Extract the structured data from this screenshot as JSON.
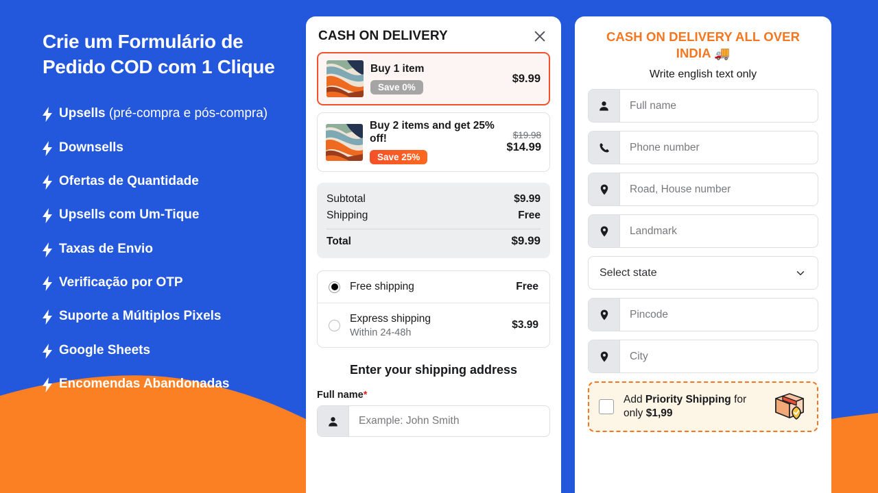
{
  "colors": {
    "brand_blue": "#2357DC",
    "brand_orange": "#FB8024",
    "accent_red": "#F4502A",
    "title_orange": "#F4761F",
    "badge_grey": "#A5A5A5"
  },
  "promo": {
    "title": "Crie um Formulário de Pedido COD com 1 Clique",
    "features": [
      {
        "strong": "Upsells",
        "rest": " (pré-compra e pós-compra)"
      },
      {
        "strong": "Downsells",
        "rest": ""
      },
      {
        "strong": "Ofertas de Quantidade",
        "rest": ""
      },
      {
        "strong": "Upsells com Um-Tique",
        "rest": ""
      },
      {
        "strong": "Taxas de Envio",
        "rest": ""
      },
      {
        "strong": "Verificação por OTP",
        "rest": ""
      },
      {
        "strong": "Suporte a Múltiplos Pixels",
        "rest": ""
      },
      {
        "strong": "Google Sheets",
        "rest": ""
      },
      {
        "strong": "Encomendas Abandonadas",
        "rest": ""
      }
    ]
  },
  "cart": {
    "title": "CASH ON DELIVERY",
    "close_label": "✕",
    "offers": [
      {
        "name": "Buy 1 item",
        "badge": "Save 0%",
        "badge_style": "grey",
        "price": "$9.99",
        "compare_at": "",
        "selected": true
      },
      {
        "name": "Buy 2 items and get 25% off!",
        "badge": "Save 25%",
        "badge_style": "hot",
        "price": "$14.99",
        "compare_at": "$19.98",
        "selected": false
      }
    ],
    "totals": [
      {
        "label": "Subtotal",
        "value": "$9.99"
      },
      {
        "label": "Shipping",
        "value": "Free"
      }
    ],
    "total": {
      "label": "Total",
      "value": "$9.99"
    },
    "shipping_methods": [
      {
        "name": "Free shipping",
        "sub": "",
        "cost": "Free",
        "selected": true
      },
      {
        "name": "Express shipping",
        "sub": "Within 24-48h",
        "cost": "$3.99",
        "selected": false
      }
    ],
    "address_heading": "Enter your shipping address",
    "fullname_label": "Full name",
    "required_mark": "*",
    "fullname_placeholder": "Example: John Smith"
  },
  "form": {
    "title": "CASH ON DELIVERY ALL OVER INDIA 🚚",
    "subtitle": "Write english text only",
    "fields": [
      {
        "icon": "person-icon",
        "placeholder": "Full name"
      },
      {
        "icon": "phone-icon",
        "placeholder": "Phone number"
      },
      {
        "icon": "location-icon",
        "placeholder": "Road, House number"
      },
      {
        "icon": "location-icon",
        "placeholder": "Landmark"
      }
    ],
    "state_select": {
      "value": "Select state"
    },
    "fields_after": [
      {
        "icon": "location-icon",
        "placeholder": "Pincode"
      },
      {
        "icon": "location-icon",
        "placeholder": "City"
      }
    ],
    "priority": {
      "prefix": "Add ",
      "strong": "Priority Shipping",
      "middle": " for only ",
      "price": "$1,99",
      "checked": false
    }
  }
}
